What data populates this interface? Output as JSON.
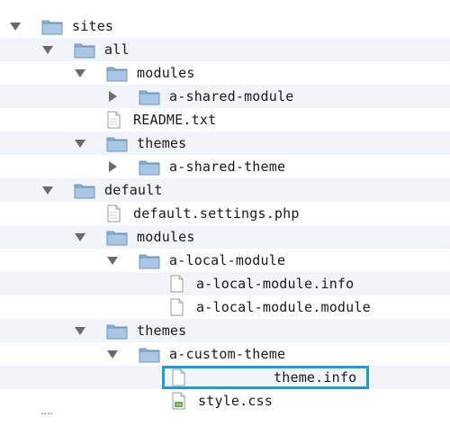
{
  "colors": {
    "folder": "#8eb1d3",
    "folder_tab": "#6f95bd",
    "highlight": "#1e9ad6",
    "row_alt": "#f1f4f9"
  },
  "tree": {
    "rows": [
      {
        "label": "sites",
        "type": "folder",
        "state": "expanded"
      },
      {
        "label": "all",
        "type": "folder",
        "state": "expanded"
      },
      {
        "label": "modules",
        "type": "folder",
        "state": "expanded"
      },
      {
        "label": "a-shared-module",
        "type": "folder",
        "state": "collapsed"
      },
      {
        "label": "README.txt",
        "type": "file"
      },
      {
        "label": "themes",
        "type": "folder",
        "state": "expanded"
      },
      {
        "label": "a-shared-theme",
        "type": "folder",
        "state": "collapsed"
      },
      {
        "label": "default",
        "type": "folder",
        "state": "expanded"
      },
      {
        "label": "default.settings.php",
        "type": "file"
      },
      {
        "label": "modules",
        "type": "folder",
        "state": "expanded"
      },
      {
        "label": "a-local-module",
        "type": "folder",
        "state": "expanded"
      },
      {
        "label": "a-local-module.info",
        "type": "file"
      },
      {
        "label": "a-local-module.module",
        "type": "file"
      },
      {
        "label": "themes",
        "type": "folder",
        "state": "expanded"
      },
      {
        "label": "a-custom-theme",
        "type": "folder",
        "state": "expanded"
      },
      {
        "label": "theme.info",
        "type": "file",
        "highlighted": true
      },
      {
        "label": "style.css",
        "type": "css-file"
      }
    ]
  }
}
